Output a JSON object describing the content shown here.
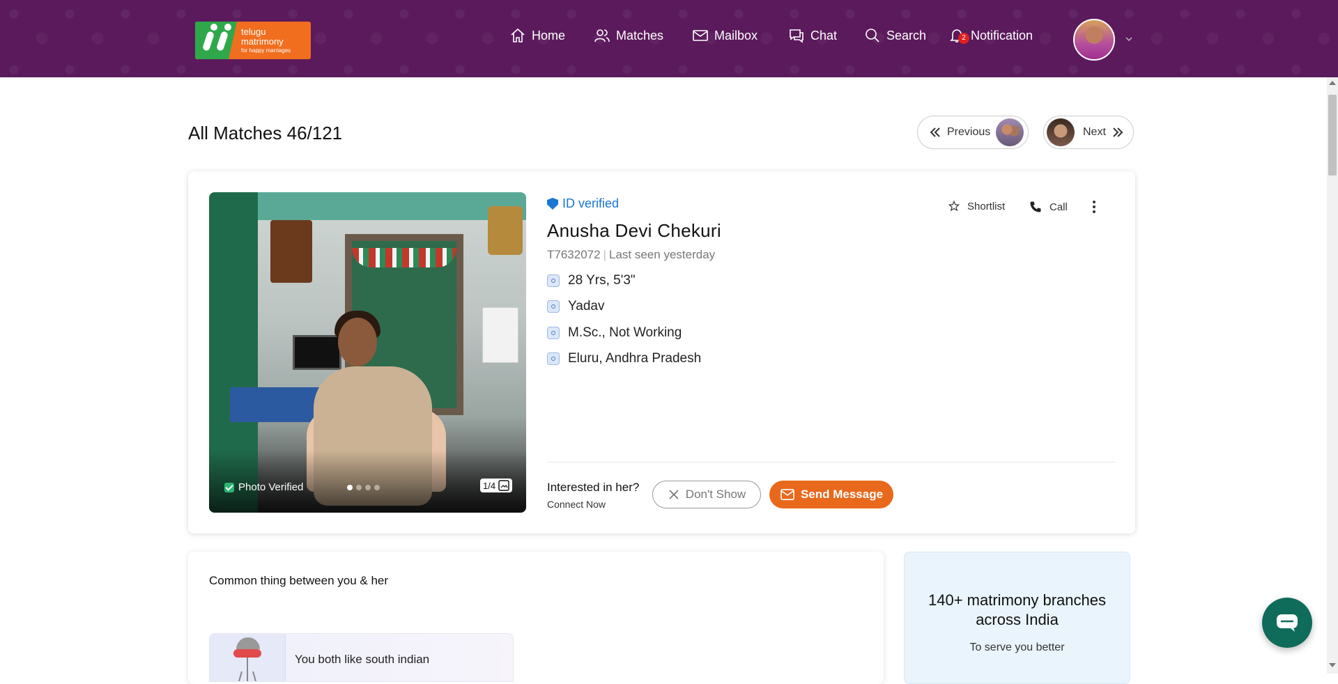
{
  "header": {
    "logo": {
      "line1": "telugu",
      "line2": "matrimony",
      "tagline": "for happy marriages"
    },
    "nav": [
      {
        "label": "Home",
        "icon": "home-icon"
      },
      {
        "label": "Matches",
        "icon": "users-icon"
      },
      {
        "label": "Mailbox",
        "icon": "mail-icon"
      },
      {
        "label": "Chat",
        "icon": "chat-icon"
      },
      {
        "label": "Search",
        "icon": "search-icon"
      },
      {
        "label": "Notification",
        "icon": "bell-icon",
        "badge": "2"
      }
    ]
  },
  "page": {
    "title": "All Matches 46/121",
    "previous_label": "Previous",
    "next_label": "Next"
  },
  "profile": {
    "id_verified": "ID verified",
    "name": "Anusha Devi Chekuri",
    "profile_id": "T7632072",
    "last_seen": "Last seen yesterday",
    "details": [
      {
        "icon": "age-icon",
        "text": "28 Yrs, 5'3\""
      },
      {
        "icon": "caste-icon",
        "text": "Yadav"
      },
      {
        "icon": "education-icon",
        "text": "M.Sc., Not Working"
      },
      {
        "icon": "location-icon",
        "text": "Eluru, Andhra Pradesh"
      }
    ],
    "photo_verified": "Photo Verified",
    "photo_count": "1/4",
    "shortlist_label": "Shortlist",
    "call_label": "Call",
    "interested_label": "Interested in her?",
    "connect_now": "Connect Now",
    "dont_show_label": "Don't Show",
    "send_message_label": "Send Message"
  },
  "common": {
    "title": "Common thing between you & her",
    "item_text": "You both like south indian"
  },
  "branches": {
    "title": "140+ matrimony branches across India",
    "subtitle": "To serve you better"
  },
  "colors": {
    "header_bg": "#5b1a5c",
    "accent_orange": "#e8691c",
    "verified_blue": "#1976d2",
    "chat_green": "#0f6b5a"
  }
}
